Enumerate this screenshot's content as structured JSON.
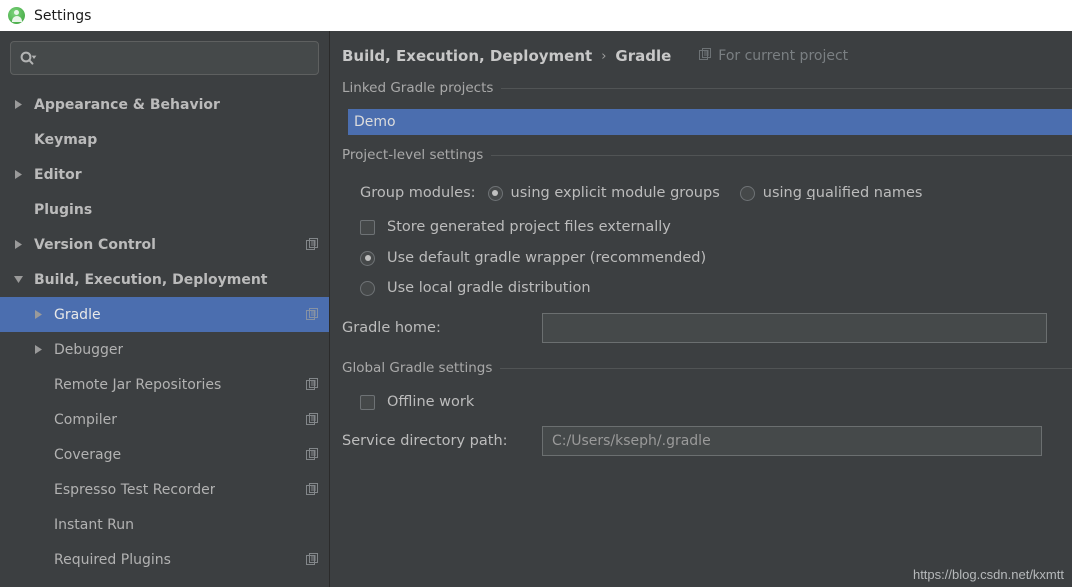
{
  "window": {
    "title": "Settings",
    "app_icon": "android-studio-icon"
  },
  "sidebar": {
    "search": {
      "placeholder": "",
      "value": "",
      "icon": "search-icon"
    },
    "items": [
      {
        "label": "Appearance & Behavior",
        "level": 0,
        "arrow": "right",
        "bold": true,
        "selected": false,
        "module_icon": false
      },
      {
        "label": "Keymap",
        "level": 0,
        "arrow": "none",
        "bold": true,
        "selected": false,
        "module_icon": false
      },
      {
        "label": "Editor",
        "level": 0,
        "arrow": "right",
        "bold": true,
        "selected": false,
        "module_icon": false
      },
      {
        "label": "Plugins",
        "level": 0,
        "arrow": "none",
        "bold": true,
        "selected": false,
        "module_icon": false
      },
      {
        "label": "Version Control",
        "level": 0,
        "arrow": "right",
        "bold": true,
        "selected": false,
        "module_icon": true
      },
      {
        "label": "Build, Execution, Deployment",
        "level": 0,
        "arrow": "down",
        "bold": true,
        "selected": false,
        "module_icon": false
      },
      {
        "label": "Gradle",
        "level": 1,
        "arrow": "right",
        "bold": false,
        "selected": true,
        "module_icon": true
      },
      {
        "label": "Debugger",
        "level": 1,
        "arrow": "right",
        "bold": false,
        "selected": false,
        "module_icon": false
      },
      {
        "label": "Remote Jar Repositories",
        "level": 1,
        "arrow": "none",
        "bold": false,
        "selected": false,
        "module_icon": true
      },
      {
        "label": "Compiler",
        "level": 1,
        "arrow": "none",
        "bold": false,
        "selected": false,
        "module_icon": true
      },
      {
        "label": "Coverage",
        "level": 1,
        "arrow": "none",
        "bold": false,
        "selected": false,
        "module_icon": true
      },
      {
        "label": "Espresso Test Recorder",
        "level": 1,
        "arrow": "none",
        "bold": false,
        "selected": false,
        "module_icon": true
      },
      {
        "label": "Instant Run",
        "level": 1,
        "arrow": "none",
        "bold": false,
        "selected": false,
        "module_icon": false
      },
      {
        "label": "Required Plugins",
        "level": 1,
        "arrow": "none",
        "bold": false,
        "selected": false,
        "module_icon": true
      }
    ]
  },
  "main": {
    "breadcrumb": {
      "parent": "Build, Execution, Deployment",
      "separator": "›",
      "current": "Gradle"
    },
    "for_current_project": {
      "label": "For current project",
      "icon": "module-copy-icon"
    },
    "linked_projects": {
      "section_title": "Linked Gradle projects",
      "rows": [
        {
          "label": "Demo",
          "selected": true
        }
      ]
    },
    "project_level": {
      "section_title": "Project-level settings",
      "group_modules_label": "Group modules:",
      "group_modules_options": [
        {
          "label_before": "using explicit module ",
          "mnemonic": "g",
          "label_after": "roups",
          "checked": true
        },
        {
          "label_before": "using ",
          "mnemonic": "q",
          "label_after": "ualified names",
          "checked": false
        }
      ],
      "store_generated": {
        "label": "Store generated project files externally",
        "checked": false
      },
      "distribution_options": [
        {
          "label": "Use default gradle wrapper (recommended)",
          "checked": true
        },
        {
          "label": "Use local gradle distribution",
          "checked": false
        }
      ],
      "gradle_home": {
        "label": "Gradle home:",
        "value": "",
        "placeholder": ""
      }
    },
    "global_settings": {
      "section_title": "Global Gradle settings",
      "offline_work": {
        "label": "Offline work",
        "checked": false
      },
      "service_directory": {
        "label": "Service directory path:",
        "value": "C:/Users/kseph/.gradle"
      }
    },
    "watermark": "https://blog.csdn.net/kxmtt"
  },
  "colors": {
    "background": "#3c3f41",
    "selection": "#4b6eaf",
    "text": "#bbbbbb",
    "titlebar": "#ffffff",
    "accent_green": "#5cb85c"
  }
}
